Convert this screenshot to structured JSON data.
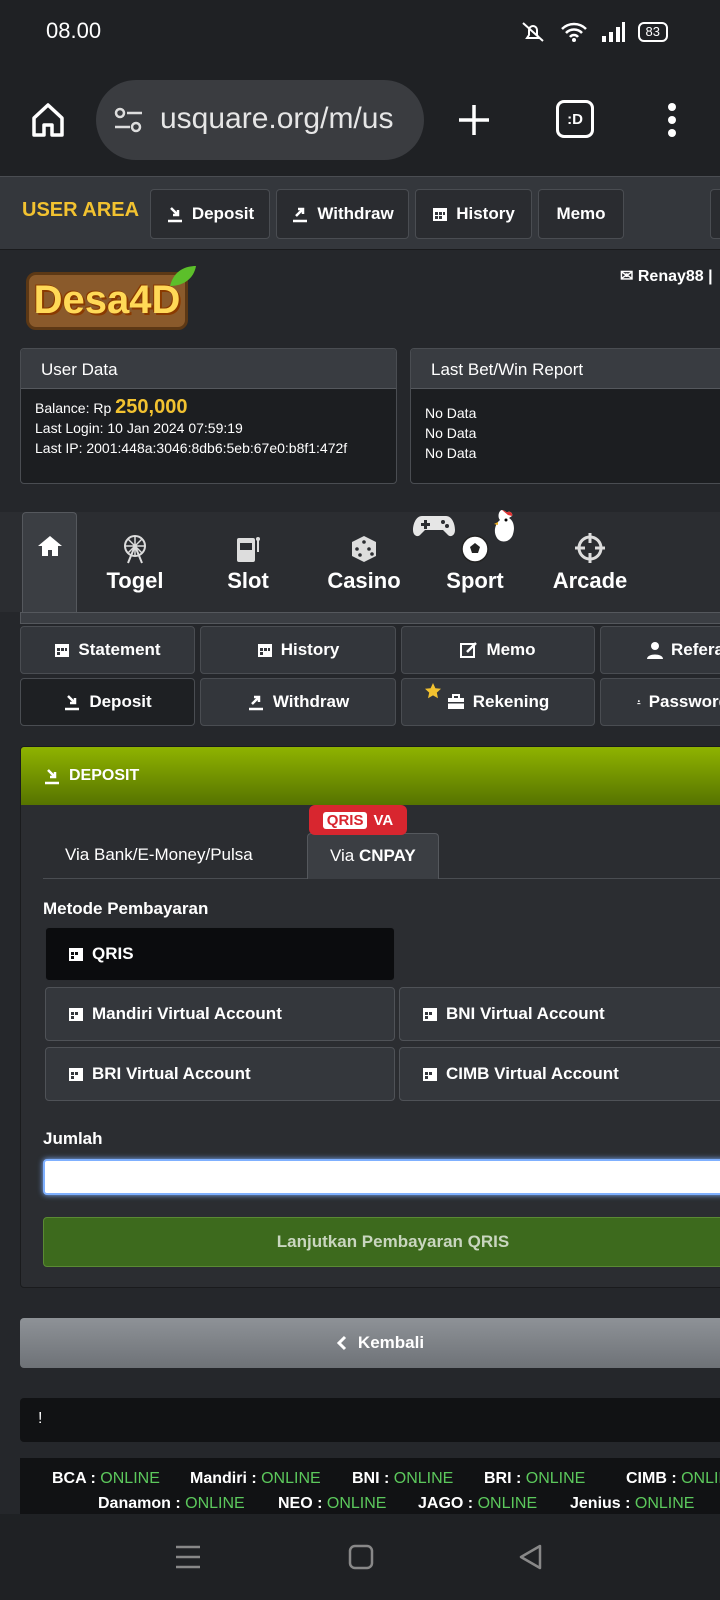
{
  "status": {
    "time": "08.00",
    "battery": "83"
  },
  "browser": {
    "url": "usquare.org/m/us",
    "tab_label": ":D"
  },
  "userbar": {
    "title": "USER AREA",
    "deposit": "Deposit",
    "withdraw": "Withdraw",
    "history": "History",
    "memo": "Memo"
  },
  "logo": {
    "text": "Desa4D"
  },
  "user": {
    "name": "Renay88 |"
  },
  "userdata": {
    "title": "User Data",
    "balance_label": "Balance: Rp",
    "balance": "250,000",
    "last_login": "Last Login: 10 Jan 2024 07:59:19",
    "last_ip": "Last IP: 2001:448a:3046:8db6:5eb:67e0:b8f1:472f"
  },
  "report": {
    "title": "Last Bet/Win Report",
    "rows": [
      "No Data",
      "No Data",
      "No Data"
    ]
  },
  "games": {
    "togel": "Togel",
    "slot": "Slot",
    "casino": "Casino",
    "sport": "Sport",
    "arcade": "Arcade"
  },
  "menu": {
    "statement": "Statement",
    "history": "History",
    "memo": "Memo",
    "referral": "Referal",
    "deposit": "Deposit",
    "withdraw": "Withdraw",
    "rekening": "Rekening",
    "password": "Password"
  },
  "deposit": {
    "title": "DEPOSIT",
    "tab_bank": "Via Bank/E-Money/Pulsa",
    "tab_cnpay_prefix": "Via",
    "tab_cnpay": "CNPAY",
    "badge_qris": "QRIS",
    "badge_va": "VA",
    "method_label": "Metode Pembayaran",
    "methods": [
      "QRIS",
      "Mandiri Virtual Account",
      "BNI Virtual Account",
      "BRI Virtual Account",
      "CIMB Virtual Account"
    ],
    "amount_label": "Jumlah",
    "amount_value": "",
    "submit": "Lanjutkan Pembayaran QRIS"
  },
  "back": "Kembali",
  "notice": "!",
  "banks": [
    {
      "name": "BCA",
      "status": "ONLINE"
    },
    {
      "name": "Mandiri",
      "status": "ONLINE"
    },
    {
      "name": "BNI",
      "status": "ONLINE"
    },
    {
      "name": "BRI",
      "status": "ONLINE"
    },
    {
      "name": "CIMB",
      "status": "ONLINE"
    },
    {
      "name": "Danamon",
      "status": "ONLINE"
    },
    {
      "name": "NEO",
      "status": "ONLINE"
    },
    {
      "name": "JAGO",
      "status": "ONLINE"
    },
    {
      "name": "Jenius",
      "status": "ONLINE"
    }
  ]
}
